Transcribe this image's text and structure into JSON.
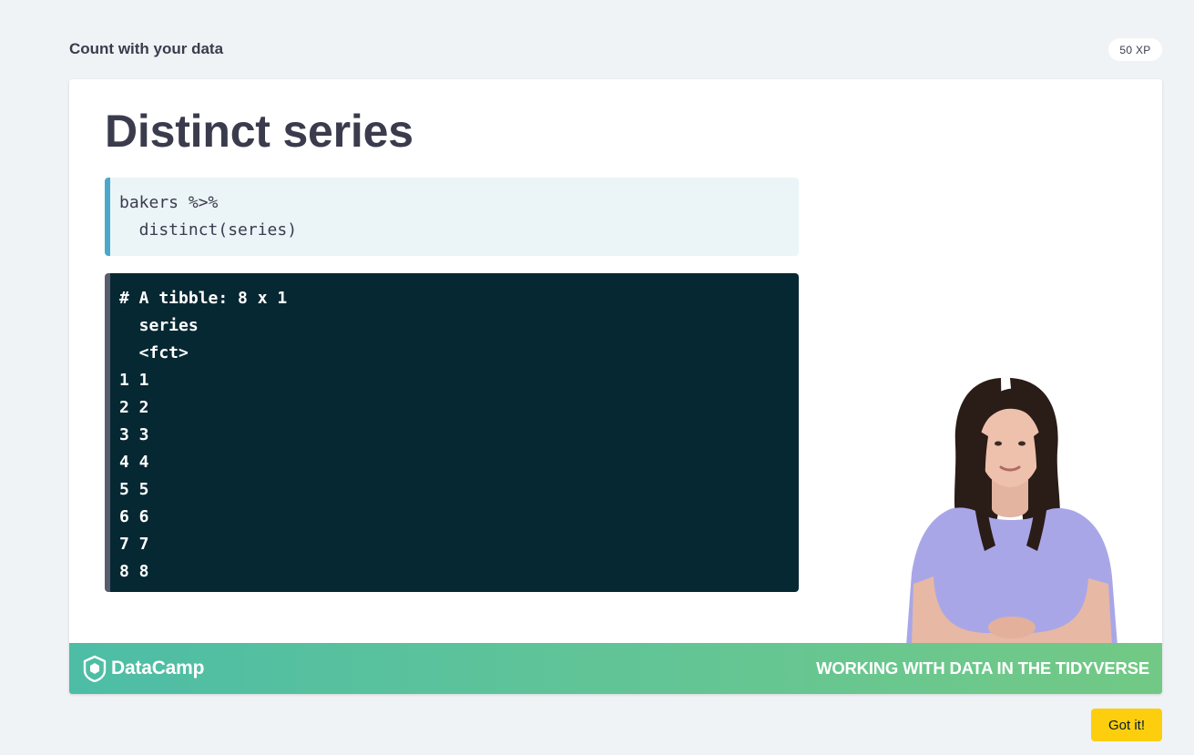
{
  "header": {
    "exercise_title": "Count with your data",
    "xp": "50 XP"
  },
  "slide": {
    "heading": "Distinct series",
    "code_lines": [
      "bakers %>%",
      "  distinct(series)"
    ],
    "output_lines": [
      "# A tibble: 8 x 1",
      "  series",
      "  <fct>",
      "1 1",
      "2 2",
      "3 3",
      "4 4",
      "5 5",
      "6 6",
      "7 7",
      "8 8"
    ]
  },
  "footer": {
    "brand": "DataCamp",
    "course": "WORKING WITH DATA IN THE TIDYVERSE"
  },
  "actions": {
    "got_it_label": "Got it!"
  },
  "colors": {
    "accent_code": "#4aa9c9",
    "output_bg": "#062833",
    "button": "#fcce0d",
    "footer_start": "#4dbda6",
    "footer_end": "#72c985"
  }
}
